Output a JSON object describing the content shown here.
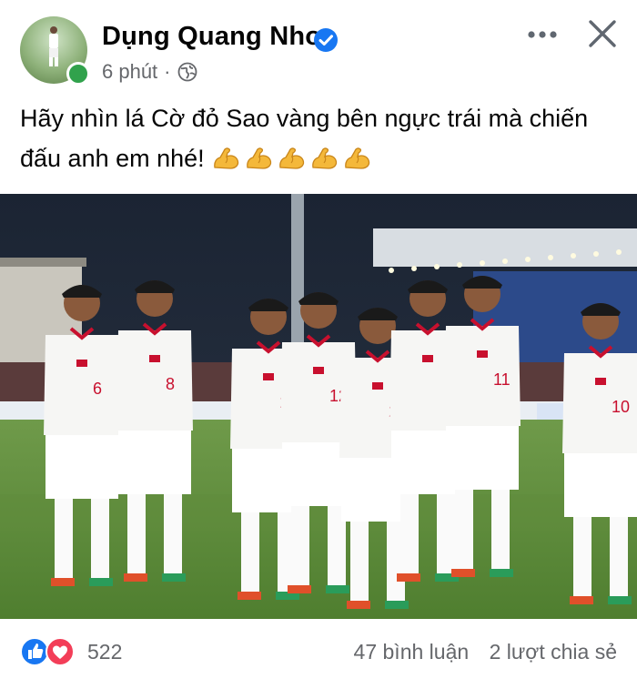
{
  "post": {
    "author": "Dụng Quang Nho",
    "timestamp": "6 phút",
    "separator": "·",
    "text": "Hãy nhìn lá Cờ đỏ Sao vàng bên ngực trái mà chiến đấu anh em nhé!",
    "emoji_count": 5
  },
  "reactions": {
    "count": "522",
    "comments": "47 bình luận",
    "shares": "2 lượt chia sẻ"
  },
  "photo": {
    "jerseys": [
      "6",
      "8",
      "19",
      "12",
      "20",
      "11",
      "10"
    ]
  },
  "icons": {
    "verified": "verified-badge-icon",
    "privacy": "globe-icon",
    "more": "more-icon",
    "close": "close-icon",
    "like": "like-icon",
    "love": "love-icon",
    "emoji": "flexed-biceps-icon"
  },
  "colors": {
    "verified": "#1877f2",
    "online": "#31a24c",
    "like": "#1877f2",
    "love": "#f33e58",
    "secondary_text": "#65676b"
  }
}
